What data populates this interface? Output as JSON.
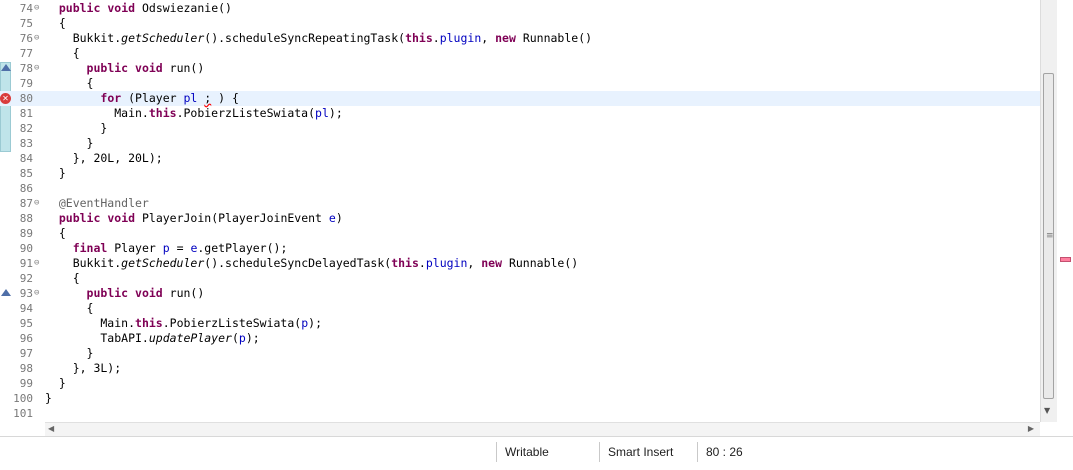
{
  "editor": {
    "cursor_line": 80,
    "lines": [
      {
        "n": "74",
        "fold": "⊖",
        "tokens": [
          [
            "  ",
            ""
          ],
          [
            "public",
            "kw"
          ],
          [
            " ",
            ""
          ],
          [
            "void",
            "kw"
          ],
          [
            " Odswiezanie()",
            ""
          ]
        ]
      },
      {
        "n": "75",
        "fold": "",
        "tokens": [
          [
            "  {",
            ""
          ]
        ]
      },
      {
        "n": "76",
        "fold": "⊖",
        "tokens": [
          [
            "    Bukkit.",
            ""
          ],
          [
            "getScheduler",
            "it"
          ],
          [
            "().scheduleSyncRepeatingTask(",
            ""
          ],
          [
            "this",
            "kw"
          ],
          [
            ".",
            ""
          ],
          [
            "plugin",
            "fld"
          ],
          [
            ", ",
            ""
          ],
          [
            "new",
            "kw"
          ],
          [
            " Runnable()",
            ""
          ]
        ]
      },
      {
        "n": "77",
        "fold": "",
        "tokens": [
          [
            "    {",
            ""
          ]
        ]
      },
      {
        "n": "78",
        "fold": "⊖",
        "marker": "override",
        "tokens": [
          [
            "      ",
            ""
          ],
          [
            "public",
            "kw"
          ],
          [
            " ",
            ""
          ],
          [
            "void",
            "kw"
          ],
          [
            " run()",
            ""
          ]
        ]
      },
      {
        "n": "79",
        "fold": "",
        "tokens": [
          [
            "      {",
            ""
          ]
        ]
      },
      {
        "n": "80",
        "fold": "",
        "marker": "error",
        "tokens": [
          [
            "        ",
            ""
          ],
          [
            "for",
            "kw"
          ],
          [
            " (Player ",
            ""
          ],
          [
            "pl",
            "fld"
          ],
          [
            " ",
            ""
          ],
          [
            ";",
            "err"
          ],
          [
            " ) {",
            ""
          ]
        ]
      },
      {
        "n": "81",
        "fold": "",
        "tokens": [
          [
            "          Main.",
            ""
          ],
          [
            "this",
            "kw"
          ],
          [
            ".PobierzListeSwiata(",
            ""
          ],
          [
            "pl",
            "fld"
          ],
          [
            ");",
            ""
          ]
        ]
      },
      {
        "n": "82",
        "fold": "",
        "tokens": [
          [
            "        }",
            ""
          ]
        ]
      },
      {
        "n": "83",
        "fold": "",
        "tokens": [
          [
            "      }",
            ""
          ]
        ]
      },
      {
        "n": "84",
        "fold": "",
        "tokens": [
          [
            "    }, 20L, 20L);",
            ""
          ]
        ]
      },
      {
        "n": "85",
        "fold": "",
        "tokens": [
          [
            "  }",
            ""
          ]
        ]
      },
      {
        "n": "86",
        "fold": "",
        "tokens": [
          [
            "",
            ""
          ]
        ]
      },
      {
        "n": "87",
        "fold": "⊖",
        "tokens": [
          [
            "  @EventHandler",
            "ann"
          ]
        ]
      },
      {
        "n": "88",
        "fold": "",
        "tokens": [
          [
            "  ",
            ""
          ],
          [
            "public",
            "kw"
          ],
          [
            " ",
            ""
          ],
          [
            "void",
            "kw"
          ],
          [
            " PlayerJoin(PlayerJoinEvent ",
            ""
          ],
          [
            "e",
            "fld"
          ],
          [
            ")",
            ""
          ]
        ]
      },
      {
        "n": "89",
        "fold": "",
        "tokens": [
          [
            "  {",
            ""
          ]
        ]
      },
      {
        "n": "90",
        "fold": "",
        "tokens": [
          [
            "    ",
            ""
          ],
          [
            "final",
            "kw"
          ],
          [
            " Player ",
            ""
          ],
          [
            "p",
            "fld"
          ],
          [
            " = ",
            ""
          ],
          [
            "e",
            "fld"
          ],
          [
            ".getPlayer();",
            ""
          ]
        ]
      },
      {
        "n": "91",
        "fold": "⊖",
        "tokens": [
          [
            "    Bukkit.",
            ""
          ],
          [
            "getScheduler",
            "it"
          ],
          [
            "().scheduleSyncDelayedTask(",
            ""
          ],
          [
            "this",
            "kw"
          ],
          [
            ".",
            ""
          ],
          [
            "plugin",
            "fld"
          ],
          [
            ", ",
            ""
          ],
          [
            "new",
            "kw"
          ],
          [
            " Runnable()",
            ""
          ]
        ]
      },
      {
        "n": "92",
        "fold": "",
        "tokens": [
          [
            "    {",
            ""
          ]
        ]
      },
      {
        "n": "93",
        "fold": "⊖",
        "marker": "override",
        "tokens": [
          [
            "      ",
            ""
          ],
          [
            "public",
            "kw"
          ],
          [
            " ",
            ""
          ],
          [
            "void",
            "kw"
          ],
          [
            " run()",
            ""
          ]
        ]
      },
      {
        "n": "94",
        "fold": "",
        "tokens": [
          [
            "      {",
            ""
          ]
        ]
      },
      {
        "n": "95",
        "fold": "",
        "tokens": [
          [
            "        Main.",
            ""
          ],
          [
            "this",
            "kw"
          ],
          [
            ".PobierzListeSwiata(",
            ""
          ],
          [
            "p",
            "fld"
          ],
          [
            ");",
            ""
          ]
        ]
      },
      {
        "n": "96",
        "fold": "",
        "tokens": [
          [
            "        TabAPI.",
            ""
          ],
          [
            "updatePlayer",
            "it"
          ],
          [
            "(",
            ""
          ],
          [
            "p",
            "fld"
          ],
          [
            ");",
            ""
          ]
        ]
      },
      {
        "n": "97",
        "fold": "",
        "tokens": [
          [
            "      }",
            ""
          ]
        ]
      },
      {
        "n": "98",
        "fold": "",
        "tokens": [
          [
            "    }, 3L);",
            ""
          ]
        ]
      },
      {
        "n": "99",
        "fold": "",
        "tokens": [
          [
            "  }",
            ""
          ]
        ]
      },
      {
        "n": "100",
        "fold": "",
        "tokens": [
          [
            "}",
            ""
          ]
        ]
      },
      {
        "n": "101",
        "fold": "",
        "tokens": [
          [
            "",
            ""
          ]
        ]
      }
    ]
  },
  "icons": {
    "error_marker": "error-icon",
    "override_marker": "override-triangle-icon",
    "fold_toggle": "minus-circle-icon",
    "scroll_up": "arrow-up-icon",
    "scroll_down": "arrow-down-icon",
    "scroll_left": "arrow-left-icon",
    "scroll_right": "arrow-right-icon",
    "error_overview_marker": "error-overview-icon"
  },
  "glyphs": {
    "error_marker": "✕",
    "scroll_down": "▼",
    "scroll_left": "◀",
    "scroll_right": "▶",
    "grip": "≡"
  },
  "colors": {
    "keyword": "#7f0055",
    "field": "#0000c0",
    "annotation": "#646464",
    "current_line": "#e8f2fe",
    "error": "#d93c3c",
    "overview_error": "#ff7f9f"
  },
  "status": {
    "writable": "Writable",
    "insert_mode": "Smart Insert",
    "position": "80 : 26"
  }
}
